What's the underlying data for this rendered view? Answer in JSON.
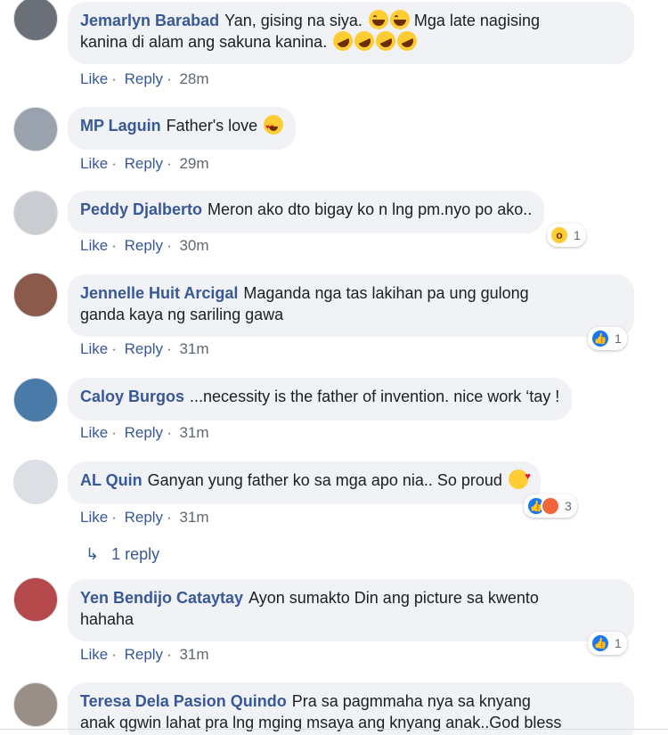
{
  "comments": [
    {
      "author": "Jemarlyn Barabad",
      "text1": "Yan, gising na siya.",
      "text2": "Mga late nagising",
      "text3": "kanina di alam ang sakuna kanina.",
      "actions": {
        "like": "Like",
        "reply": "Reply",
        "time": "28m"
      },
      "avatar_color": "#6b6f78"
    },
    {
      "author": "MP Laguin",
      "text": "Father's love",
      "actions": {
        "like": "Like",
        "reply": "Reply",
        "time": "29m"
      },
      "avatar_color": "#9aa3ad"
    },
    {
      "author": "Peddy Djalberto",
      "text": "Meron ako dto bigay ko n lng pm.nyo po ako..",
      "actions": {
        "like": "Like",
        "reply": "Reply",
        "time": "30m"
      },
      "reactions": {
        "count": "1",
        "types": [
          "wow-icon"
        ]
      },
      "avatar_color": "#c9cdd2"
    },
    {
      "author": "Jennelle Huit Arcigal",
      "text1": "Maganda nga tas lakihan pa ung gulong",
      "text2": "ganda kaya ng sariling gawa",
      "actions": {
        "like": "Like",
        "reply": "Reply",
        "time": "31m"
      },
      "reactions": {
        "count": "1",
        "types": [
          "like-icon"
        ]
      },
      "avatar_color": "#8c5a4a"
    },
    {
      "author": "Caloy Burgos",
      "text": "...necessity is the father of invention. nice work ‘tay !",
      "actions": {
        "like": "Like",
        "reply": "Reply",
        "time": "31m"
      },
      "avatar_color": "#4a7aa8"
    },
    {
      "author": "AL Quin",
      "text": "Ganyan yung father ko sa mga apo nia.. So proud",
      "actions": {
        "like": "Like",
        "reply": "Reply",
        "time": "31m"
      },
      "reactions": {
        "count": "3",
        "types": [
          "like-icon",
          "angry-icon"
        ]
      },
      "replies_link": "1 reply",
      "avatar_color": "#dcdfe3"
    },
    {
      "author": "Yen Bendijo Cataytay",
      "text1": "Ayon sumakto Din ang picture sa kwento",
      "text2": "hahaha",
      "actions": {
        "like": "Like",
        "reply": "Reply",
        "time": "31m"
      },
      "reactions": {
        "count": "1",
        "types": [
          "like-icon"
        ]
      },
      "avatar_color": "#b5484a"
    },
    {
      "author": "Teresa Dela Pasion Quindo",
      "text1": "Pra sa pagmmaha nya sa knyang",
      "text2": "anak qgwin lahat pra lng mging msaya ang knyang anak..God bless",
      "avatar_color": "#9a8f86"
    }
  ],
  "colors": {
    "author": "#385898",
    "bubble": "#f0f2f5",
    "time": "#606770",
    "like_reaction": "#1877f2"
  }
}
